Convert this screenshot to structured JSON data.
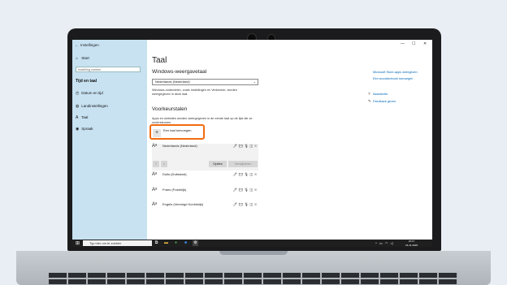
{
  "window": {
    "title": "Instellingen",
    "minimize": "—",
    "maximize": "☐",
    "close": "✕"
  },
  "sidebar": {
    "home_label": "Start",
    "search_placeholder": "Instelling zoeken",
    "section_heading": "Tijd en taal",
    "items": [
      {
        "icon": "date-time-icon",
        "glyph": "◴",
        "label": "Datum en tijd"
      },
      {
        "icon": "region-icon",
        "glyph": "◍",
        "label": "Landinstellingen"
      },
      {
        "icon": "language-icon",
        "glyph": "A",
        "label": "Taal"
      },
      {
        "icon": "speech-icon",
        "glyph": "◉",
        "label": "Spraak"
      }
    ]
  },
  "main": {
    "title": "Taal",
    "display_language_heading": "Windows-weergavetaal",
    "display_language_value": "Nederlands (Nederland)",
    "display_language_desc": "Windows-onderdelen, zoals Instellingen en Verkenner, worden weergegeven in deze taal.",
    "preferred_heading": "Voorkeurstalen",
    "preferred_desc": "Apps en websites worden weergegeven in de eerste taal op de lijst die ze ondersteunen.",
    "add_language_label": "Een taal toevoegen",
    "languages": [
      {
        "name": "Nederlands (Nederland)",
        "caps": "🖋 ✉ 🎙 ◫ ☉"
      },
      {
        "name": "Duits (Duitsland)",
        "caps": "🖋 ✉ 🎙 ◫ ☉"
      },
      {
        "name": "Frans (Frankrijk)",
        "caps": "🖋 ✉ 🎙 ◫ ☉"
      },
      {
        "name": "Engels (Verenigd Koninkrijk)",
        "caps": "🖋 ✉ 🎙 ◫ ☉"
      }
    ],
    "options_button": "Opties",
    "remove_button": "Verwijderen",
    "move_up": "↑",
    "move_down": "↓"
  },
  "related": {
    "links": [
      "Microsoft Store-apps weergeven",
      "Een woordenboek toevoegen"
    ],
    "help_label": "Assistentie",
    "feedback_label": "Feedback geven"
  },
  "taskbar": {
    "search_placeholder": "Typ hier om te zoeken",
    "time": "10:17",
    "date": "16-11-2020"
  },
  "colors": {
    "sidebar_bg": "#c8e2f2",
    "highlight": "#f26b10",
    "link": "#0067b8"
  }
}
